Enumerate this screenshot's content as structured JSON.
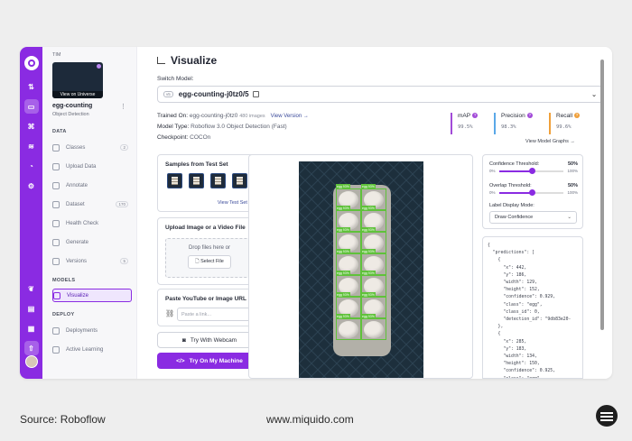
{
  "sidebar": {
    "team": "TIM",
    "thumb_caption": "View on Universe",
    "project_name": "egg-counting",
    "project_type": "Object Detection",
    "sections": {
      "data": "DATA",
      "models": "MODELS",
      "deploy": "DEPLOY"
    },
    "items": [
      {
        "label": "Classes",
        "badge": "2"
      },
      {
        "label": "Upload Data",
        "badge": ""
      },
      {
        "label": "Annotate",
        "badge": ""
      },
      {
        "label": "Dataset",
        "badge": "170"
      },
      {
        "label": "Health Check",
        "badge": ""
      },
      {
        "label": "Generate",
        "badge": ""
      },
      {
        "label": "Versions",
        "badge": "5"
      },
      {
        "label": "Visualize",
        "badge": ""
      },
      {
        "label": "Deployments",
        "badge": ""
      },
      {
        "label": "Active Learning",
        "badge": ""
      }
    ]
  },
  "header": {
    "title": "Visualize",
    "switch_model_label": "Switch Model:"
  },
  "model": {
    "version_badge": "v5",
    "selected": "egg-counting-j0tz0/5",
    "trained_on_label": "Trained On:",
    "trained_on_value": "egg-counting-j0tz0",
    "images": "480 images",
    "view_version": "View Version →",
    "model_type_label": "Model Type:",
    "model_type_value": "Roboflow 3.0 Object Detection (Fast)",
    "checkpoint_label": "Checkpoint:",
    "checkpoint_value": "COCOn"
  },
  "metrics": [
    {
      "name": "mAP",
      "value": "99.5%",
      "color": "#a24bd8"
    },
    {
      "name": "Precision",
      "value": "98.3%",
      "color": "#5aa8e8"
    },
    {
      "name": "Recall",
      "value": "99.6%",
      "color": "#f0a03a"
    }
  ],
  "view_model_graphs": "View Model Graphs →",
  "samples": {
    "title": "Samples from Test Set",
    "link": "View Test Set →"
  },
  "upload": {
    "title": "Upload Image or a Video File",
    "drop_text": "Drop files here or",
    "select_file": "Select File"
  },
  "paste": {
    "title": "Paste YouTube or Image URL",
    "placeholder": "Paste a link..."
  },
  "webcam_button": "Try With Webcam",
  "machine_button": "Try On My Machine",
  "controls": {
    "confidence_label": "Confidence Threshold:",
    "confidence_value": "50%",
    "confidence_level": 0.5,
    "overlap_label": "Overlap Threshold:",
    "overlap_value": "50%",
    "overlap_level": 0.5,
    "range_min": "0%",
    "range_max": "100%",
    "label_display_label": "Label Display Mode:",
    "label_display_value": "Draw Confidence"
  },
  "detection_label": "egg 93%",
  "json_output": "{\n  \"predictions\": [\n    {\n      \"x\": 442,\n      \"y\": 186,\n      \"width\": 129,\n      \"height\": 152,\n      \"confidence\": 0.929,\n      \"class\": \"egg\",\n      \"class_id\": 0,\n      \"detection_id\": \"9db83e20-\n    },\n    {\n      \"x\": 285,\n      \"y\": 183,\n      \"width\": 134,\n      \"height\": 150,\n      \"confidence\": 0.925,\n      \"class\": \"egg\",\n      \"class_id\": 0,",
  "footer": {
    "source": "Source: Roboflow",
    "site": "www.miquido.com"
  }
}
